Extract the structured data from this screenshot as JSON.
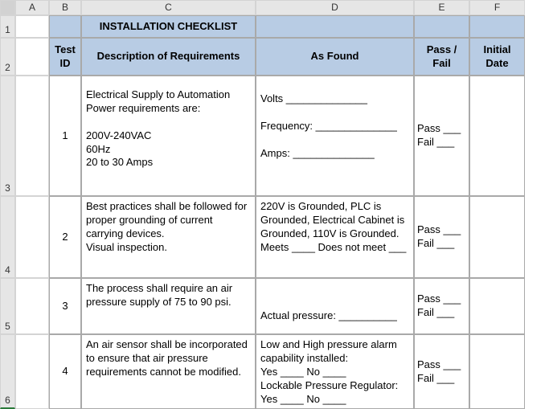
{
  "columns": [
    "",
    "A",
    "B",
    "C",
    "D",
    "E",
    "F"
  ],
  "rowNumbers": [
    "1",
    "2",
    "3",
    "4",
    "5",
    "6"
  ],
  "headers": {
    "title": "INSTALLATION CHECKLIST",
    "testId": "Test ID",
    "description": "Description of Requirements",
    "asFound": "As Found",
    "passFail": "Pass / Fail",
    "initialDate": "Initial Date"
  },
  "rows": [
    {
      "id": "1",
      "description": "Electrical Supply to Automation Power requirements are:\n\n200V-240VAC\n60Hz\n20 to 30 Amps",
      "asFound": "Volts ______________\n\nFrequency: ______________\n\nAmps:   ______________",
      "passFail": "Pass ___\nFail ___"
    },
    {
      "id": "2",
      "description": "Best practices shall be followed for proper grounding of current carrying devices.\nVisual inspection.",
      "asFound": "220V is Grounded, PLC is Grounded, Electrical Cabinet is Grounded, 110V is Grounded.\nMeets ____   Does not meet ___",
      "passFail": "Pass ___\nFail ___"
    },
    {
      "id": "3",
      "description": "The process shall require an air pressure supply of 75 to 90 psi.",
      "asFound": "\n\nActual pressure: __________",
      "passFail": "Pass ___\nFail ___"
    },
    {
      "id": "4",
      "description": "An air sensor shall be incorporated to ensure that air pressure requirements cannot be modified.",
      "asFound": "Low and High pressure alarm capability installed:\nYes ____       No ____\nLockable Pressure Regulator:\nYes ____       No ____",
      "passFail": "Pass ___\nFail ___"
    }
  ]
}
